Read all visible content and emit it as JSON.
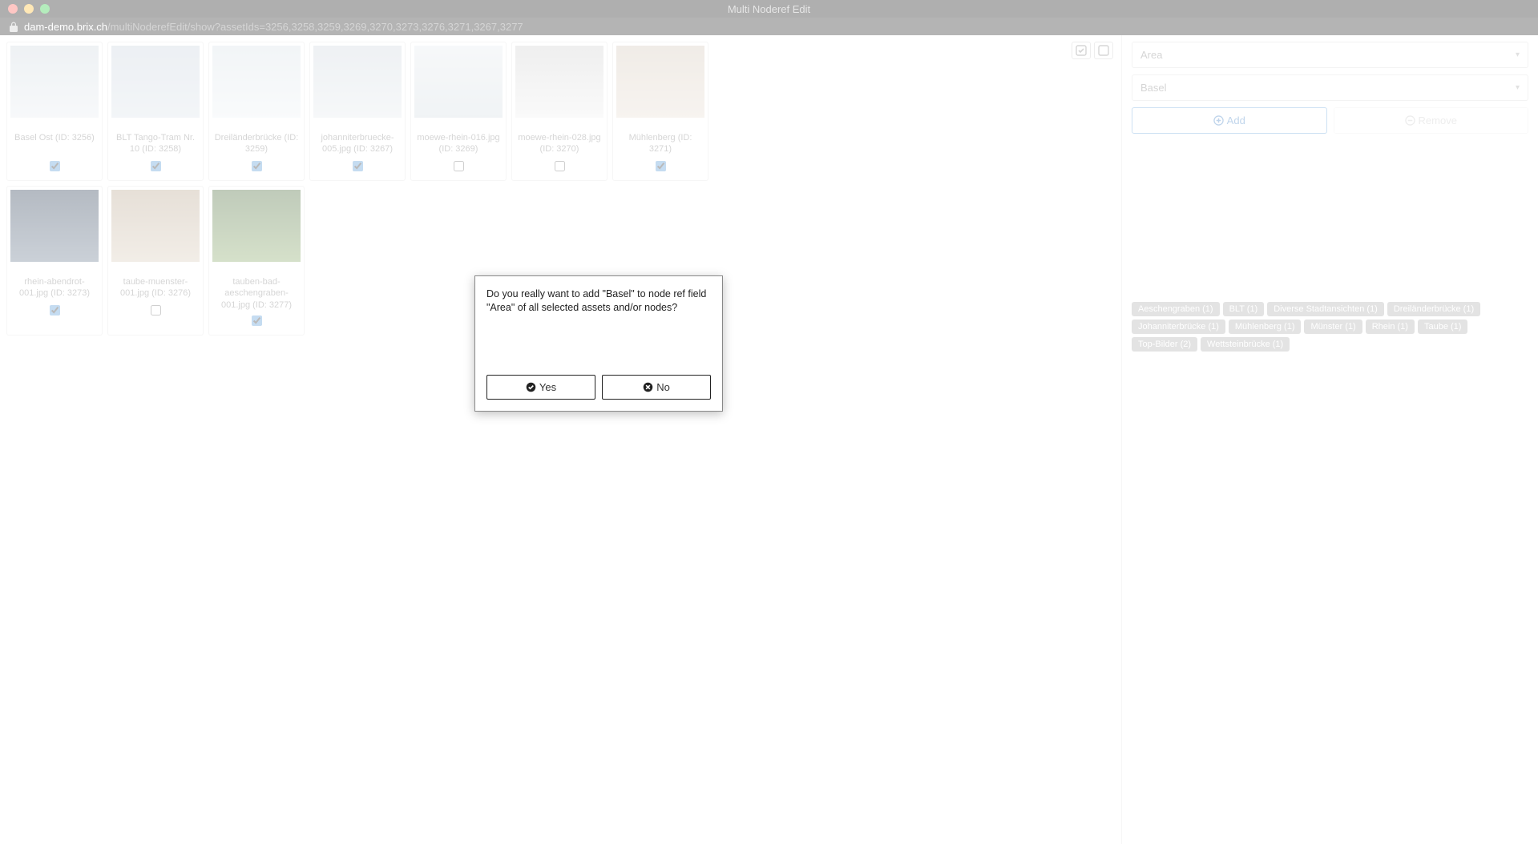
{
  "window": {
    "title": "Multi Noderef Edit",
    "url_host": "dam-demo.brix.ch",
    "url_path": "/multiNoderefEdit/show?assetIds=3256,3258,3259,3269,3270,3273,3276,3271,3267,3277"
  },
  "assets": [
    {
      "label": "Basel Ost (ID: 3256)",
      "checked": true
    },
    {
      "label": "BLT Tango-Tram Nr. 10 (ID: 3258)",
      "checked": true
    },
    {
      "label": "Dreiländerbrücke (ID: 3259)",
      "checked": true
    },
    {
      "label": "johanniterbruecke-005.jpg (ID: 3267)",
      "checked": true
    },
    {
      "label": "moewe-rhein-016.jpg (ID: 3269)",
      "checked": false
    },
    {
      "label": "moewe-rhein-028.jpg (ID: 3270)",
      "checked": false
    },
    {
      "label": "Mühlenberg (ID: 3271)",
      "checked": true
    },
    {
      "label": "rhein-abendrot-001.jpg (ID: 3273)",
      "checked": true
    },
    {
      "label": "taube-muenster-001.jpg (ID: 3276)",
      "checked": false
    },
    {
      "label": "tauben-bad-aeschengraben-001.jpg (ID: 3277)",
      "checked": true
    }
  ],
  "sidebar": {
    "field_select": "Area",
    "value_select": "Basel",
    "add_label": "Add",
    "remove_label": "Remove",
    "tags": [
      "Aeschengraben (1)",
      "BLT (1)",
      "Diverse Stadtansichten (1)",
      "Dreiländerbrücke (1)",
      "Johanniterbrücke (1)",
      "Mühlenberg (1)",
      "Münster (1)",
      "Rhein (1)",
      "Taube (1)",
      "Top-Bilder (2)",
      "Wettsteinbrücke (1)"
    ]
  },
  "dialog": {
    "message": "Do you really want to add \"Basel\" to node ref field \"Area\" of all selected assets and/or nodes?",
    "yes": "Yes",
    "no": "No"
  }
}
